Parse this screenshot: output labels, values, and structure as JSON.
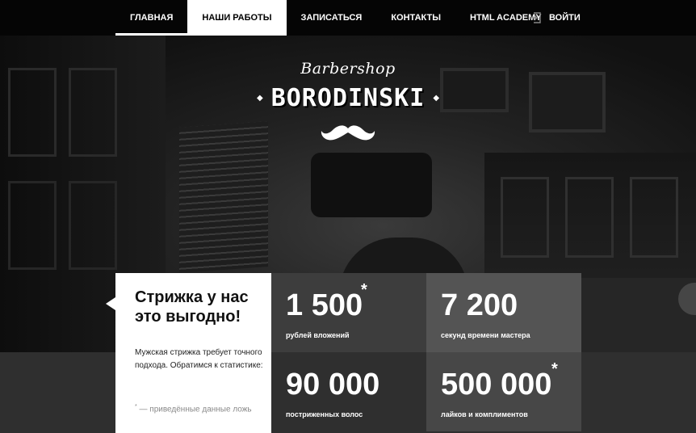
{
  "nav": {
    "items": [
      {
        "label": "ГЛАВНАЯ"
      },
      {
        "label": "НАШИ РАБОТЫ"
      },
      {
        "label": "ЗАПИСАТЬСЯ"
      },
      {
        "label": "КОНТАКТЫ"
      },
      {
        "label": "HTML ACADEMY"
      }
    ],
    "login": "ВОЙТИ"
  },
  "logo": {
    "script": "Barbershop",
    "brand": "BORODINSKI",
    "icon": "mustache-icon"
  },
  "promo": {
    "title_line1": "Стрижка у нас",
    "title_line2": "это выгодно!",
    "text": "Мужская стрижка требует точного подхода. Обратимся к статистике:",
    "foot_mark": "*",
    "foot": " — приведённые данные ложь"
  },
  "stats": [
    {
      "value": "1 500",
      "asterisk": "*",
      "label": "рублей вложений"
    },
    {
      "value": "7 200",
      "asterisk": "",
      "label": "секунд времени мастера"
    },
    {
      "value": "90 000",
      "asterisk": "",
      "label": "постриженных волос"
    },
    {
      "value": "500 000",
      "asterisk": "*",
      "label": "лайков и комплиментов"
    }
  ],
  "colors": {
    "nav_bg": "#050505",
    "selected_bg": "#ffffff",
    "stat_bg_1": "#3d3d3d",
    "stat_bg_2": "#545454",
    "stat_bg_3": "#2f2f2f",
    "stat_bg_4": "#474747"
  }
}
